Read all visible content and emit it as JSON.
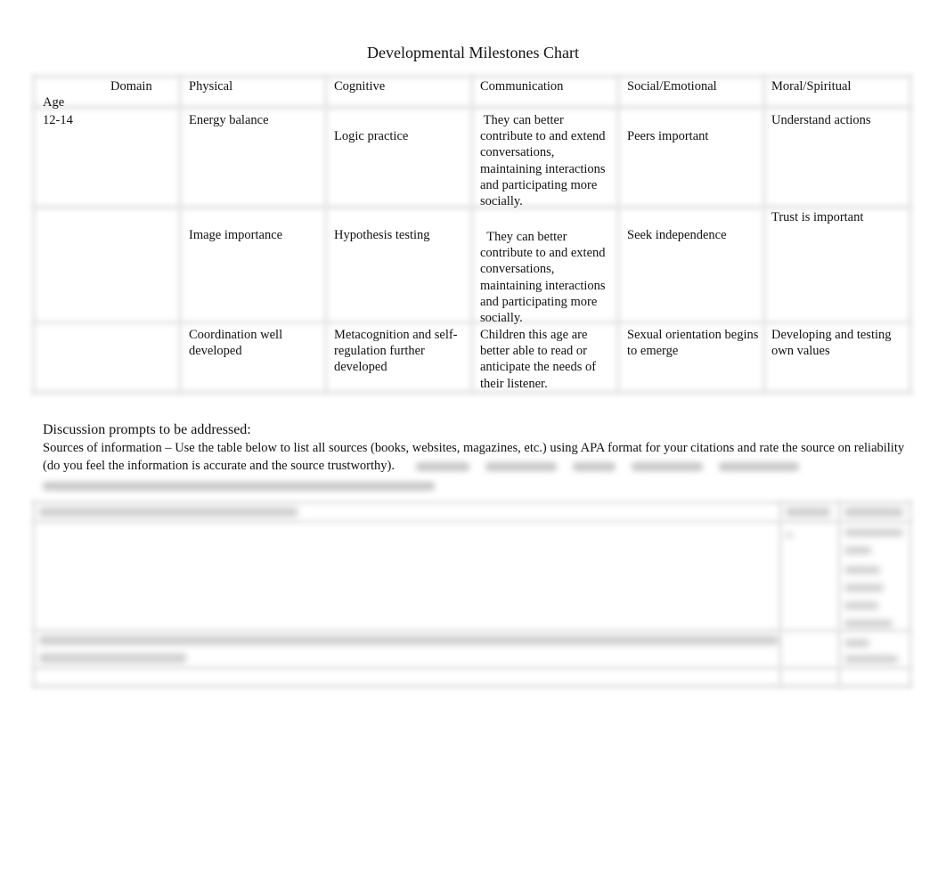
{
  "document": {
    "title": "Developmental Milestones Chart"
  },
  "milestones_table": {
    "header": {
      "domain_label": "Domain",
      "age_label": "Age",
      "columns": [
        "Physical",
        "Cognitive",
        "Communication",
        "Social/Emotional",
        "Moral/Spiritual"
      ]
    },
    "rows": [
      {
        "age": "12-14",
        "physical": "Energy balance",
        "cognitive": "Logic practice",
        "communication": " They can better contribute to and extend conversations, maintaining interactions and participating more socially.",
        "social_emotional": "Peers important",
        "moral_spiritual": "Understand actions"
      },
      {
        "age": "",
        "physical": "Image importance",
        "cognitive": "Hypothesis testing",
        "communication": "  They can better contribute to and extend conversations, maintaining interactions and participating more socially.",
        "social_emotional": "Seek independence",
        "moral_spiritual": "Trust is important"
      },
      {
        "age": "",
        "physical": "Coordination well developed",
        "cognitive": "Metacognition and self-regulation further developed",
        "communication": "Children this age are better able to read or anticipate the needs of their listener.",
        "social_emotional": "Sexual orientation begins to emerge",
        "moral_spiritual": "Developing and testing own values"
      }
    ]
  },
  "discussion": {
    "heading": "Discussion prompts to be addressed:",
    "sources_intro": "Sources of information  – Use the table below to list all sources (books, websites, magazines, etc.) using APA format for your citations and rate the source on reliability (do you feel the information is accurate and the source trustworthy)."
  },
  "sources_table": {
    "content_state": "blurred"
  }
}
